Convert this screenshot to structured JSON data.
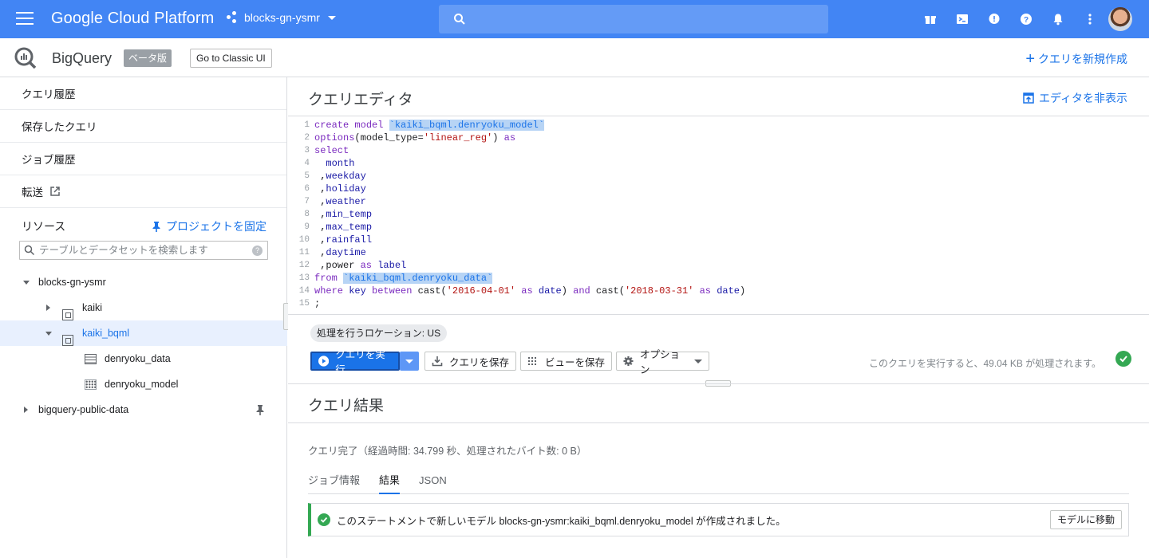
{
  "topbar": {
    "product": "Google Cloud Platform",
    "project": "blocks-gn-ysmr",
    "bg_color": "#4285f4"
  },
  "subheader": {
    "product": "BigQuery",
    "beta": "ベータ版",
    "classic_button": "Go to Classic UI",
    "new_query": "クエリを新規作成"
  },
  "sidebar": {
    "items": [
      {
        "label": "クエリ履歴"
      },
      {
        "label": "保存したクエリ"
      },
      {
        "label": "ジョブ履歴"
      },
      {
        "label": "転送"
      }
    ],
    "resources_label": "リソース",
    "pin_project": "プロジェクトを固定",
    "search_placeholder": "テーブルとデータセットを検索します",
    "tree": {
      "project": "blocks-gn-ysmr",
      "dataset1": "kaiki",
      "dataset2": "kaiki_bqml",
      "table": "denryoku_data",
      "model": "denryoku_model",
      "public": "bigquery-public-data"
    }
  },
  "editor": {
    "title": "クエリエディタ",
    "hide_editor": "エディタを非表示",
    "line_numbers": [
      "1",
      "2",
      "3",
      "4",
      "5",
      "6",
      "7",
      "8",
      "9",
      "10",
      "11",
      "12",
      "13",
      "14",
      "15"
    ],
    "location_chip": "処理を行うロケーション: US",
    "run_button": "クエリを実行",
    "save_query_button": "クエリを保存",
    "save_view_button": "ビューを保存",
    "options_button": "オプション",
    "bytes_info": "このクエリを実行すると、49.04 KB が処理されます。"
  },
  "results": {
    "title": "クエリ結果",
    "complete_text": "クエリ完了（経過時間: 34.799 秒、処理されたバイト数: 0 B）",
    "tabs": [
      "ジョブ情報",
      "結果",
      "JSON"
    ],
    "active_tab": "結果",
    "message": "このステートメントで新しいモデル blocks-gn-ysmr:kaiki_bqml.denryoku_model が作成されました。",
    "goto_model": "モデルに移動"
  }
}
